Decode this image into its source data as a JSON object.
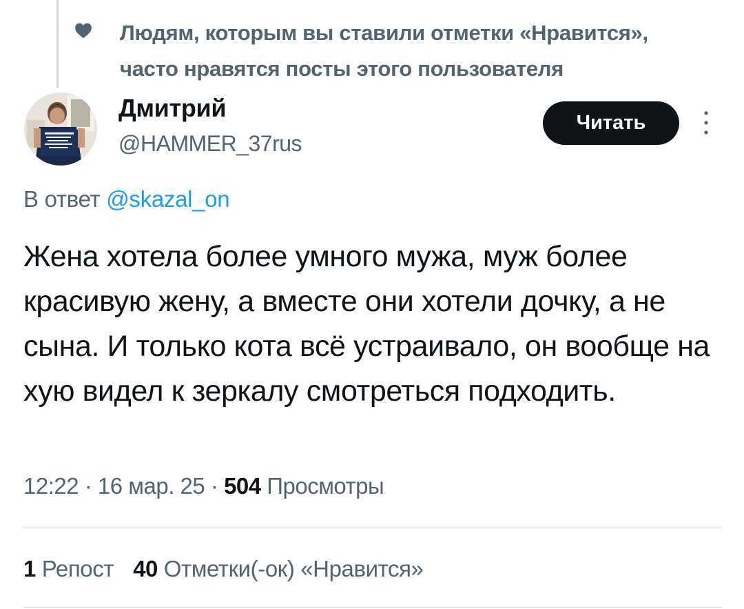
{
  "social_context": {
    "text": "Людям, которым вы ставили отметки «Нравится»,\nчасто нравятся посты этого пользователя"
  },
  "author": {
    "name": "Дмитрий",
    "handle": "@HAMMER_37rus"
  },
  "follow_button": {
    "label": "Читать"
  },
  "reply": {
    "prefix": "В ответ ",
    "mention": "@skazal_on"
  },
  "tweet": {
    "text": "Жена хотела более умного мужа, муж более красивую жену, а вместе они хотели дочку, а не сына. И только кота всё устраивало, он вообще на хую видел к зеркалу смотреться подходить."
  },
  "meta": {
    "time": "12:22",
    "separator": " · ",
    "date": "16 мар. 25",
    "views_count": "504",
    "views_label": " Просмотры"
  },
  "stats": {
    "reposts_count": "1",
    "reposts_label": " Репост",
    "likes_count": "40",
    "likes_label": " Отметки(-ок) «Нравится»"
  },
  "icons": {
    "heart": "heart-icon",
    "more": "more-vertical-icon"
  },
  "colors": {
    "text_primary": "#0f1419",
    "text_secondary": "#536471",
    "link": "#1d9bf0",
    "button_bg": "#0f1419",
    "divider": "#cfd9de"
  }
}
